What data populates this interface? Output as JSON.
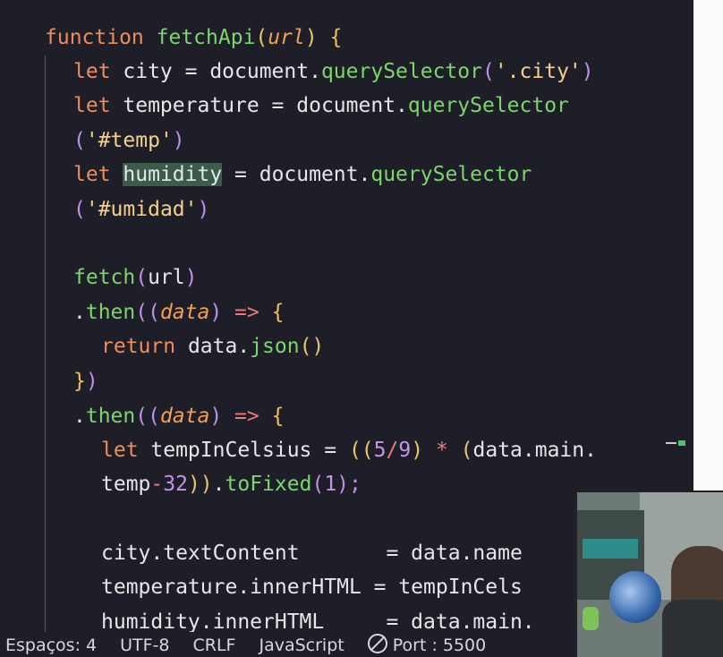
{
  "code": {
    "l1": {
      "kw": "function",
      "sp": " ",
      "fn": "fetchApi",
      "p1": "(",
      "arg": "url",
      "p2": ")",
      "sp2": " ",
      "brace": "{"
    },
    "l2": {
      "kw": "let",
      "a": " city = document.",
      "fn": "querySelector",
      "p1": "(",
      "str": "'.city'",
      "p2": ")"
    },
    "l3": {
      "kw": "let",
      "a": " temperature = document.",
      "fn": "querySelector"
    },
    "l4": {
      "p1": "(",
      "str": "'#temp'",
      "p2": ")"
    },
    "l5": {
      "kw": "let",
      "sp": " ",
      "hl": "humidity",
      "a": " = document.",
      "fn": "querySelector"
    },
    "l6": {
      "p1": "(",
      "str": "'#umidad'",
      "p2": ")"
    },
    "l8": {
      "fn": "fetch",
      "p1": "(",
      "a": "url",
      "p2": ")"
    },
    "l9": {
      "dot": ".",
      "fn": "then",
      "p1": "((",
      "arg": "data",
      "p2": ")",
      "op": " => ",
      "brace": "{"
    },
    "l10": {
      "kw": "return",
      "a": " data.",
      "fn": "json",
      "p": "()"
    },
    "l11": {
      "brace": "}",
      "p": ")"
    },
    "l12": {
      "dot": ".",
      "fn": "then",
      "p1": "((",
      "arg": "data",
      "p2": ")",
      "op": " => ",
      "brace": "{"
    },
    "l13": {
      "kw": "let",
      "a": " tempInCelsius = ",
      "p1": "((",
      "n1": "5",
      "s": "/",
      "n2": "9",
      "p2": ")",
      "op": " * ",
      "p3": "(",
      "b": "data.main."
    },
    "l14": {
      "a": "temp",
      "op": "-",
      "n": "32",
      "p": "))",
      "dot": ".",
      "fn": "toFixed",
      "p1": "(",
      "n2": "1",
      "p2": ");"
    },
    "l16": {
      "a": "city.textContent       = data.name"
    },
    "l17": {
      "a": "temperature.innerHTML = tempInCels"
    },
    "l18": {
      "a": "humidity.innerHTML     = data.main."
    }
  },
  "statusbar": {
    "spaces": "Espaços: 4",
    "encoding": "UTF-8",
    "eol": "CRLF",
    "language": "JavaScript",
    "port": "Port : 5500"
  }
}
